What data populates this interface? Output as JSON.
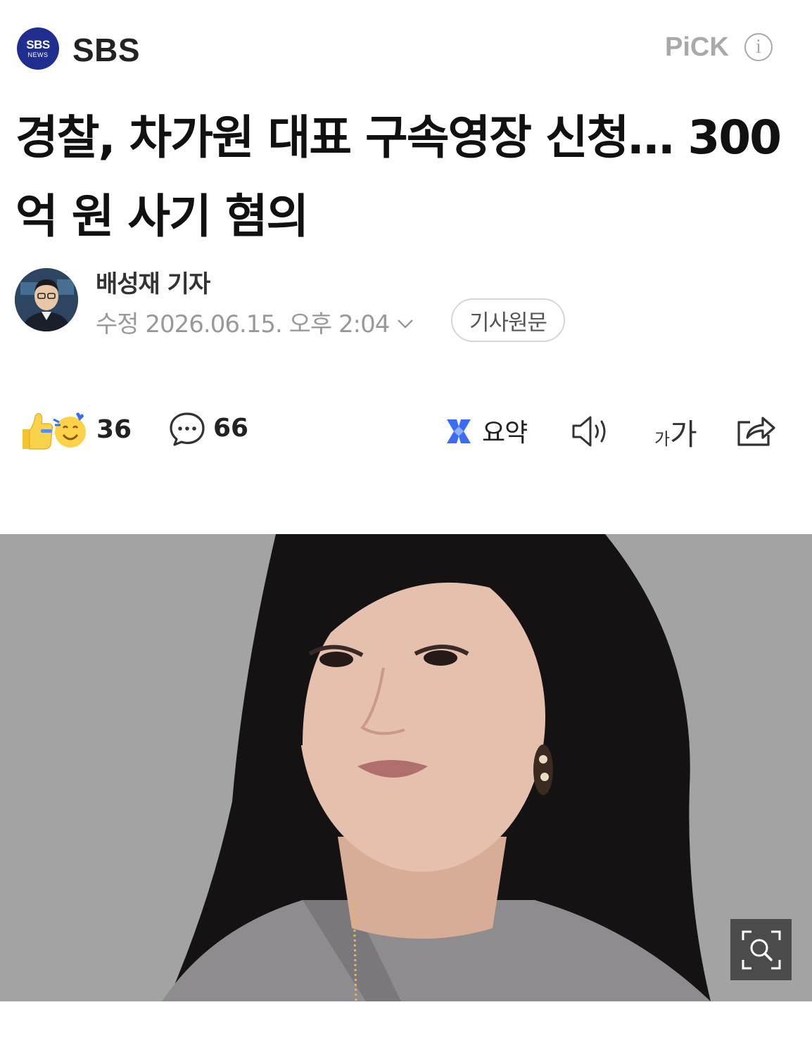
{
  "header": {
    "logo_line1": "SBS",
    "logo_line2": "NEWS",
    "press_name": "SBS",
    "pick_label": "PiCK",
    "info_icon": "info-icon"
  },
  "article": {
    "title": "경찰, 차가원 대표 구속영장 신청… 300억 원 사기 혐의",
    "reporter": "배성재 기자",
    "date_label": "수정 2026.06.15. 오후 2:04",
    "original_button": "기사원문"
  },
  "actions": {
    "reaction_count": "36",
    "comment_count": "66",
    "summary_label": "요약",
    "font_small": "가",
    "font_large": "가",
    "icons": [
      "thumbs-up-icon",
      "smile-icon",
      "comment-icon",
      "summary-icon",
      "speaker-icon",
      "font-size-icon",
      "share-icon"
    ]
  },
  "photo": {
    "zoom_icon": "zoom-icon"
  },
  "colors": {
    "logo_bg": "#1f2e8f",
    "muted": "#999999",
    "summary_blue": "#3b6cf6"
  }
}
